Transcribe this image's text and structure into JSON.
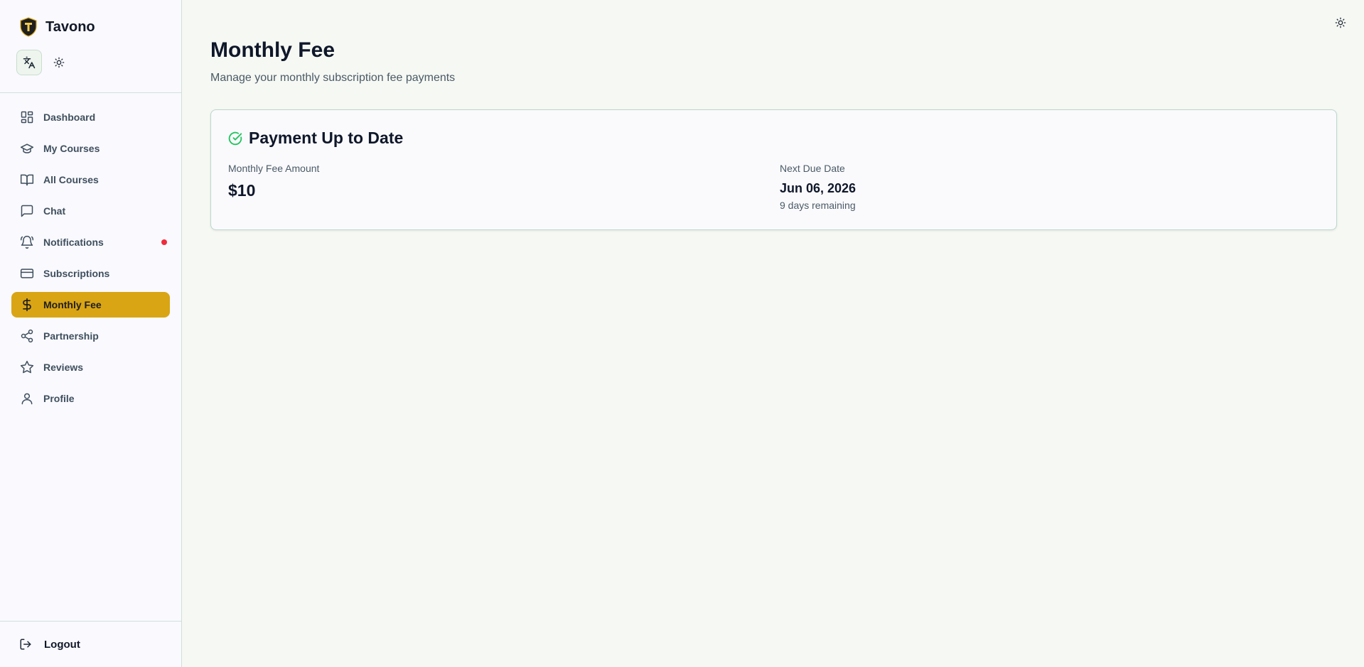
{
  "brand": {
    "name": "Tavono"
  },
  "sidebar": {
    "items": [
      {
        "label": "Dashboard",
        "icon": "dashboard-icon"
      },
      {
        "label": "My Courses",
        "icon": "graduation-cap-icon"
      },
      {
        "label": "All Courses",
        "icon": "book-open-icon"
      },
      {
        "label": "Chat",
        "icon": "message-square-icon"
      },
      {
        "label": "Notifications",
        "icon": "bell-icon",
        "badge": "unread"
      },
      {
        "label": "Subscriptions",
        "icon": "credit-card-icon"
      },
      {
        "label": "Monthly Fee",
        "icon": "dollar-sign-icon",
        "active": true
      },
      {
        "label": "Partnership",
        "icon": "share-icon"
      },
      {
        "label": "Reviews",
        "icon": "star-icon"
      },
      {
        "label": "Profile",
        "icon": "user-icon"
      }
    ],
    "logout_label": "Logout"
  },
  "page": {
    "title": "Monthly Fee",
    "subtitle": "Manage your monthly subscription fee payments"
  },
  "card": {
    "title": "Payment Up to Date",
    "amount_label": "Monthly Fee Amount",
    "amount_value": "$10",
    "due_label": "Next Due Date",
    "due_value": "Jun 06, 2026",
    "due_note": "9 days remaining"
  },
  "colors": {
    "accent": "#d9a514",
    "success": "#22c55e",
    "notification_dot": "#ef2b3d"
  }
}
